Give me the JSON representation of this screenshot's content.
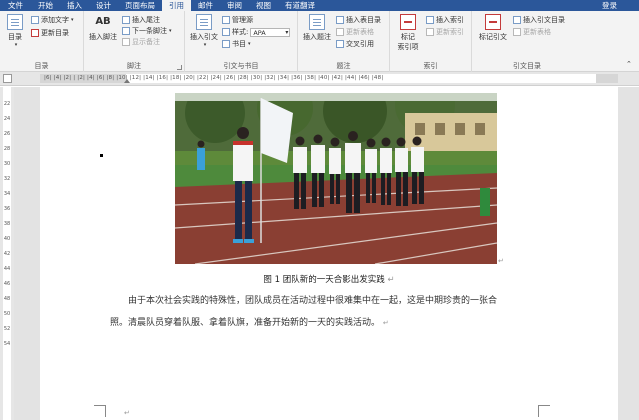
{
  "tabs": {
    "file": "文件",
    "items": [
      "开始",
      "插入",
      "设计",
      "页面布局",
      "引用",
      "邮件",
      "审阅",
      "视图",
      "有道翻译"
    ],
    "active_index": 4,
    "signin": "登录"
  },
  "ribbon": {
    "toc": {
      "big_label": "目录",
      "add_text": "添加文字",
      "update_toc": "更新目录",
      "group_label": "目录"
    },
    "footnotes": {
      "big_icon_text": "AB",
      "big_label": "插入脚注",
      "insert_endnote": "插入尾注",
      "next_footnote": "下一条脚注",
      "show_notes": "显示备注",
      "group_label": "脚注"
    },
    "citations": {
      "big_label": "插入引文",
      "manage_sources": "管理源",
      "style_label": "样式:",
      "style_value": "APA",
      "bibliography": "书目",
      "group_label": "引文与书目"
    },
    "captions": {
      "big_label": "插入题注",
      "insert_table_of_figures": "插入表目录",
      "update_table": "更新表格",
      "cross_reference": "交叉引用",
      "group_label": "题注"
    },
    "index": {
      "big_label_line1": "标记",
      "big_label_line2": "索引项",
      "insert_index": "插入索引",
      "update_index": "更新索引",
      "group_label": "索引"
    },
    "toa": {
      "big_label": "标记引文",
      "insert_toa": "插入引文目录",
      "update_table": "更新表格",
      "group_label": "引文目录"
    }
  },
  "ruler": {
    "horizontal": "|6| |4| |2| |  |2| |4| |6| |8| |10| |12| |14| |16| |18| |20| |22| |24| |26| |28| |30| |32| |34| |36| |38| |40| |42| |44| |46| |48|",
    "vertical": [
      "22",
      "24",
      "26",
      "28",
      "30",
      "32",
      "34",
      "36",
      "38",
      "40",
      "42",
      "44",
      "46",
      "48",
      "50",
      "52",
      "54"
    ]
  },
  "document": {
    "caption": "图 1 团队新的一天合影出发实践",
    "paragraph_line1": "由于本次社会实践的特殊性，团队成员在活动过程中很难集中在一起，这是中期珍贵的一张合",
    "paragraph_line2": "照。清晨队员穿着队服、拿着队旗，准备开始新的一天的实践活动。",
    "paragraph_mark": "↵"
  },
  "colors": {
    "tabbar": "#2b579a",
    "ribbon": "#f3f3f3",
    "canvas": "#e3e3e3"
  }
}
